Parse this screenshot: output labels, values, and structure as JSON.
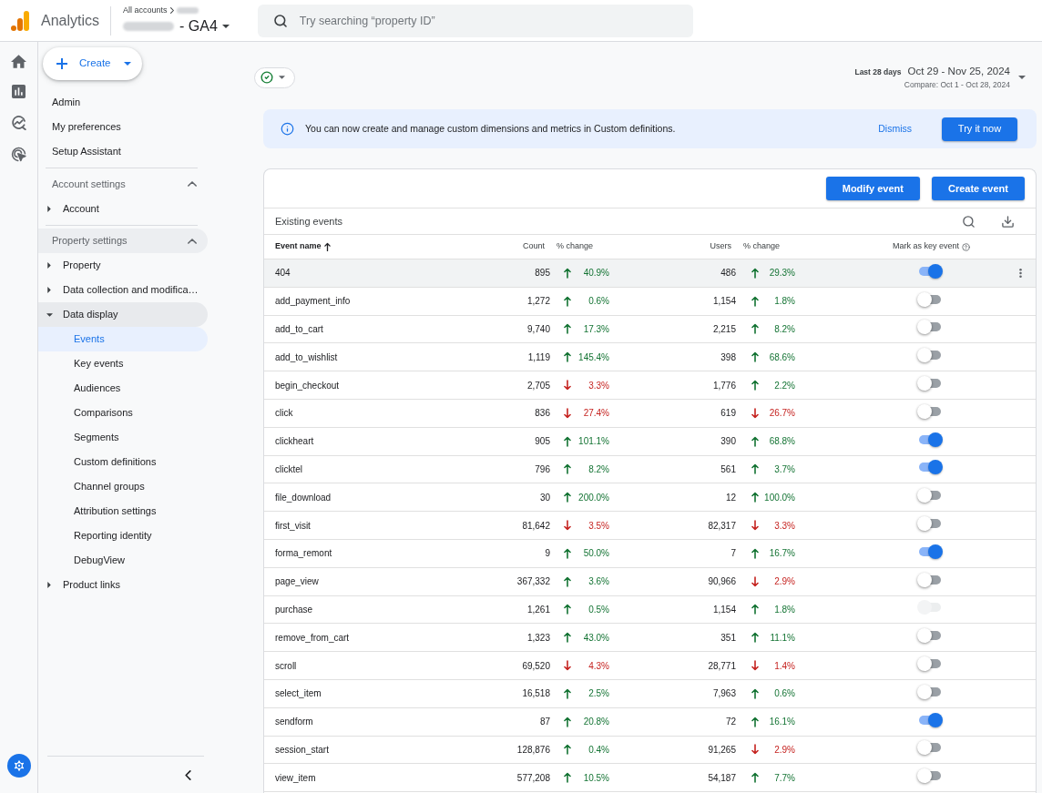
{
  "header": {
    "product_name": "Analytics",
    "breadcrumb": "All accounts",
    "property_suffix": "- GA4",
    "search": {
      "placeholder": "Try searching “property ID”"
    }
  },
  "create_button": {
    "label": "Create"
  },
  "sidebar": {
    "top_items": [
      {
        "label": "Admin"
      },
      {
        "label": "My preferences"
      },
      {
        "label": "Setup Assistant"
      }
    ],
    "sections": [
      {
        "title": "Account settings",
        "expanded": true,
        "hovered": false,
        "items": [
          {
            "label": "Account",
            "expanded": false
          }
        ]
      },
      {
        "title": "Property settings",
        "expanded": true,
        "hovered": true,
        "items": [
          {
            "label": "Property",
            "expanded": false
          },
          {
            "label": "Data collection and modifica…",
            "expanded": false
          },
          {
            "label": "Data display",
            "expanded": true,
            "children": [
              {
                "label": "Events",
                "selected": true
              },
              {
                "label": "Key events",
                "selected": false
              },
              {
                "label": "Audiences",
                "selected": false
              },
              {
                "label": "Comparisons",
                "selected": false
              },
              {
                "label": "Segments",
                "selected": false
              },
              {
                "label": "Custom definitions",
                "selected": false
              },
              {
                "label": "Channel groups",
                "selected": false
              },
              {
                "label": "Attribution settings",
                "selected": false
              },
              {
                "label": "Reporting identity",
                "selected": false
              },
              {
                "label": "DebugView",
                "selected": false
              }
            ]
          },
          {
            "label": "Product links",
            "expanded": false
          }
        ]
      }
    ]
  },
  "date_range": {
    "preset": "Last 28 days",
    "range": "Oct 29 - Nov 25, 2024",
    "compare": "Compare: Oct 1 - Oct 28, 2024"
  },
  "banner": {
    "message": "You can now create and manage custom dimensions and metrics in Custom definitions.",
    "dismiss": "Dismiss",
    "action": "Try it now"
  },
  "table": {
    "buttons": [
      "Modify event",
      "Create event"
    ],
    "title": "Existing events",
    "columns": [
      {
        "label": "Event name",
        "sorted": true
      },
      {
        "label": "Count",
        "sorted": false
      },
      {
        "label": "% change",
        "sorted": false
      },
      {
        "label": "Users",
        "sorted": false
      },
      {
        "label": "% change",
        "sorted": false
      },
      {
        "label": "Mark as key event",
        "sorted": false
      }
    ],
    "rows": [
      {
        "name": "404",
        "count": "895",
        "count_change": {
          "rising": true,
          "value": "40.9%"
        },
        "users": "486",
        "users_change": {
          "rising": true,
          "value": "29.3%"
        },
        "key_event": {
          "on": true,
          "disabled": false
        },
        "hovered": true
      },
      {
        "name": "add_payment_info",
        "count": "1,272",
        "count_change": {
          "rising": true,
          "value": "0.6%"
        },
        "users": "1,154",
        "users_change": {
          "rising": true,
          "value": "1.8%"
        },
        "key_event": {
          "on": false,
          "disabled": false
        },
        "hovered": false
      },
      {
        "name": "add_to_cart",
        "count": "9,740",
        "count_change": {
          "rising": true,
          "value": "17.3%"
        },
        "users": "2,215",
        "users_change": {
          "rising": true,
          "value": "8.2%"
        },
        "key_event": {
          "on": false,
          "disabled": false
        },
        "hovered": false
      },
      {
        "name": "add_to_wishlist",
        "count": "1,119",
        "count_change": {
          "rising": true,
          "value": "145.4%"
        },
        "users": "398",
        "users_change": {
          "rising": true,
          "value": "68.6%"
        },
        "key_event": {
          "on": false,
          "disabled": false
        },
        "hovered": false
      },
      {
        "name": "begin_checkout",
        "count": "2,705",
        "count_change": {
          "rising": false,
          "value": "3.3%"
        },
        "users": "1,776",
        "users_change": {
          "rising": true,
          "value": "2.2%"
        },
        "key_event": {
          "on": false,
          "disabled": false
        },
        "hovered": false
      },
      {
        "name": "click",
        "count": "836",
        "count_change": {
          "rising": false,
          "value": "27.4%"
        },
        "users": "619",
        "users_change": {
          "rising": false,
          "value": "26.7%"
        },
        "key_event": {
          "on": false,
          "disabled": false
        },
        "hovered": false
      },
      {
        "name": "clickheart",
        "count": "905",
        "count_change": {
          "rising": true,
          "value": "101.1%"
        },
        "users": "390",
        "users_change": {
          "rising": true,
          "value": "68.8%"
        },
        "key_event": {
          "on": true,
          "disabled": false
        },
        "hovered": false
      },
      {
        "name": "clicktel",
        "count": "796",
        "count_change": {
          "rising": true,
          "value": "8.2%"
        },
        "users": "561",
        "users_change": {
          "rising": true,
          "value": "3.7%"
        },
        "key_event": {
          "on": true,
          "disabled": false
        },
        "hovered": false
      },
      {
        "name": "file_download",
        "count": "30",
        "count_change": {
          "rising": true,
          "value": "200.0%"
        },
        "users": "12",
        "users_change": {
          "rising": true,
          "value": "100.0%"
        },
        "key_event": {
          "on": false,
          "disabled": false
        },
        "hovered": false
      },
      {
        "name": "first_visit",
        "count": "81,642",
        "count_change": {
          "rising": false,
          "value": "3.5%"
        },
        "users": "82,317",
        "users_change": {
          "rising": false,
          "value": "3.3%"
        },
        "key_event": {
          "on": false,
          "disabled": false
        },
        "hovered": false
      },
      {
        "name": "forma_remont",
        "count": "9",
        "count_change": {
          "rising": true,
          "value": "50.0%"
        },
        "users": "7",
        "users_change": {
          "rising": true,
          "value": "16.7%"
        },
        "key_event": {
          "on": true,
          "disabled": false
        },
        "hovered": false
      },
      {
        "name": "page_view",
        "count": "367,332",
        "count_change": {
          "rising": true,
          "value": "3.6%"
        },
        "users": "90,966",
        "users_change": {
          "rising": false,
          "value": "2.9%"
        },
        "key_event": {
          "on": false,
          "disabled": false
        },
        "hovered": false
      },
      {
        "name": "purchase",
        "count": "1,261",
        "count_change": {
          "rising": true,
          "value": "0.5%"
        },
        "users": "1,154",
        "users_change": {
          "rising": true,
          "value": "1.8%"
        },
        "key_event": {
          "on": false,
          "disabled": true
        },
        "hovered": false
      },
      {
        "name": "remove_from_cart",
        "count": "1,323",
        "count_change": {
          "rising": true,
          "value": "43.0%"
        },
        "users": "351",
        "users_change": {
          "rising": true,
          "value": "11.1%"
        },
        "key_event": {
          "on": false,
          "disabled": false
        },
        "hovered": false
      },
      {
        "name": "scroll",
        "count": "69,520",
        "count_change": {
          "rising": false,
          "value": "4.3%"
        },
        "users": "28,771",
        "users_change": {
          "rising": false,
          "value": "1.4%"
        },
        "key_event": {
          "on": false,
          "disabled": false
        },
        "hovered": false
      },
      {
        "name": "select_item",
        "count": "16,518",
        "count_change": {
          "rising": true,
          "value": "2.5%"
        },
        "users": "7,963",
        "users_change": {
          "rising": true,
          "value": "0.6%"
        },
        "key_event": {
          "on": false,
          "disabled": false
        },
        "hovered": false
      },
      {
        "name": "sendform",
        "count": "87",
        "count_change": {
          "rising": true,
          "value": "20.8%"
        },
        "users": "72",
        "users_change": {
          "rising": true,
          "value": "16.1%"
        },
        "key_event": {
          "on": true,
          "disabled": false
        },
        "hovered": false
      },
      {
        "name": "session_start",
        "count": "128,876",
        "count_change": {
          "rising": true,
          "value": "0.4%"
        },
        "users": "91,265",
        "users_change": {
          "rising": false,
          "value": "2.9%"
        },
        "key_event": {
          "on": false,
          "disabled": false
        },
        "hovered": false
      },
      {
        "name": "view_item",
        "count": "577,208",
        "count_change": {
          "rising": true,
          "value": "10.5%"
        },
        "users": "54,187",
        "users_change": {
          "rising": true,
          "value": "7.7%"
        },
        "key_event": {
          "on": false,
          "disabled": false
        },
        "hovered": false
      }
    ]
  }
}
